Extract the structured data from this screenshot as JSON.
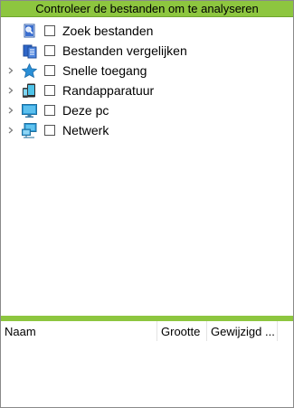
{
  "header": {
    "title": "Controleer de bestanden om te analyseren"
  },
  "tree": {
    "items": [
      {
        "label": "Zoek bestanden",
        "icon": "search-files-icon",
        "expandable": false,
        "checked": false
      },
      {
        "label": "Bestanden vergelijken",
        "icon": "compare-files-icon",
        "expandable": false,
        "checked": false
      },
      {
        "label": "Snelle toegang",
        "icon": "star-icon",
        "expandable": true,
        "checked": false
      },
      {
        "label": "Randapparatuur",
        "icon": "devices-icon",
        "expandable": true,
        "checked": false
      },
      {
        "label": "Deze pc",
        "icon": "computer-icon",
        "expandable": true,
        "checked": false
      },
      {
        "label": "Netwerk",
        "icon": "network-icon",
        "expandable": true,
        "checked": false
      }
    ]
  },
  "file_list": {
    "columns": {
      "name": "Naam",
      "size": "Grootte",
      "modified": "Gewijzigd ..."
    }
  },
  "colors": {
    "accent": "#8dc63f",
    "border": "#8a8a8a"
  }
}
